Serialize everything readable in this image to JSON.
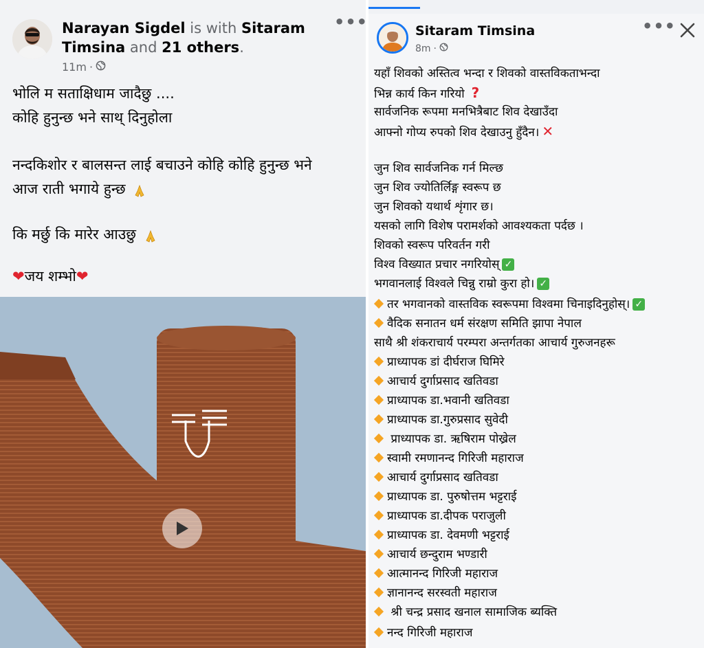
{
  "left_post": {
    "author": "Narayan Sigdel",
    "is_with": "is with",
    "tagged": "Sitaram",
    "tagged2": "Timsina",
    "and": "and",
    "others": "21 others",
    "period": ".",
    "time": "11m",
    "lines": [
      "भोलि म सताक्षिधाम जादैछु ....",
      "कोहि हुनुन्छ भने साथ् दिनुहोला",
      "नन्दकिशोर र बालसन्त लाई बचाउने कोहि कोहि हुनुन्छ भने",
      "आज राती भगाये हुन्छ",
      "कि मर्छु कि मारेर आउछु",
      "जय शम्भो"
    ]
  },
  "right_post": {
    "author": "Sitaram Timsina",
    "time": "8m",
    "lines": [
      "यहाँ शिवको अस्तित्व भन्दा र शिवको वास्तविकताभन्दा",
      " भिन्न कार्य किन गरियो",
      "सार्वजनिक रूपमा  मनभित्रैबाट   शिव देखाउँदा",
      "आफ्नो गोप्य रुपको शिव देखाउनु हुँदैन।",
      "जुन शिव सार्वजनिक गर्न मिल्छ",
      "जुन शिव ज्योतिर्लिङ्ग स्वरूप छ",
      "जुन शिवको यथार्थ शृंगार छ।",
      " यसको लागि विशेष परामर्शको आवश्यकता पर्दछ ।",
      "शिवको स्वरूप परिवर्तन गरी",
      " विश्व विख्यात प्रचार नगरियोस्",
      "भगवानलाई विश्वले चिन्नु राम्रो कुरा हो।",
      "तर भगवानको वास्तविक स्वरूपमा विश्वमा चिनाइदिनुहोस्।",
      "वैदिक सनातन धर्म संरक्षण समिति झापा नेपाल",
      "साथै श्री शंकराचार्य परम्परा अन्तर्गतका आचार्य गुरुजनहरू",
      "प्राध्यापक डां दीर्घराज घिमिरे",
      "आचार्य दुर्गाप्रसाद खतिवडा",
      "प्राध्यापक डा.भवानी खतिवडा",
      "प्राध्यापक डा.गुरुप्रसाद सुवेदी",
      " प्राध्यापक डा. ऋषिराम पोख्रेल",
      "स्वामी रमणानन्द गिरिजी महाराज",
      "आचार्य दुर्गाप्रसाद खतिवडा",
      "प्राध्यापक डा. पुरुषोत्तम भट्टराई",
      "प्राध्यापक  डा.दीपक पराजुली",
      "प्राध्यापक डा. देवमणी भट्टराई",
      "आचार्य छन्दुराम  भण्डारी",
      "आत्मानन्द गिरिजी महाराज",
      "ज्ञानानन्द सरस्वती महाराज",
      " श्री  चन्द्र प्रसाद खनाल सामाजिक ब्यक्ति",
      "नन्द गिरिजी महाराज"
    ]
  },
  "icons": {
    "globe": "globe-icon",
    "more": "more-options-icon",
    "close": "close-icon",
    "play": "play-icon",
    "check": "check-mark-icon",
    "diamond": "orange-diamond-icon",
    "heart": "red-heart-icon",
    "pray": "folded-hands-icon"
  },
  "colors": {
    "link_blue": "#1877f2",
    "muted": "#65676b",
    "diamond": "#f5a524",
    "check": "#43b047",
    "red": "#e0242f"
  }
}
